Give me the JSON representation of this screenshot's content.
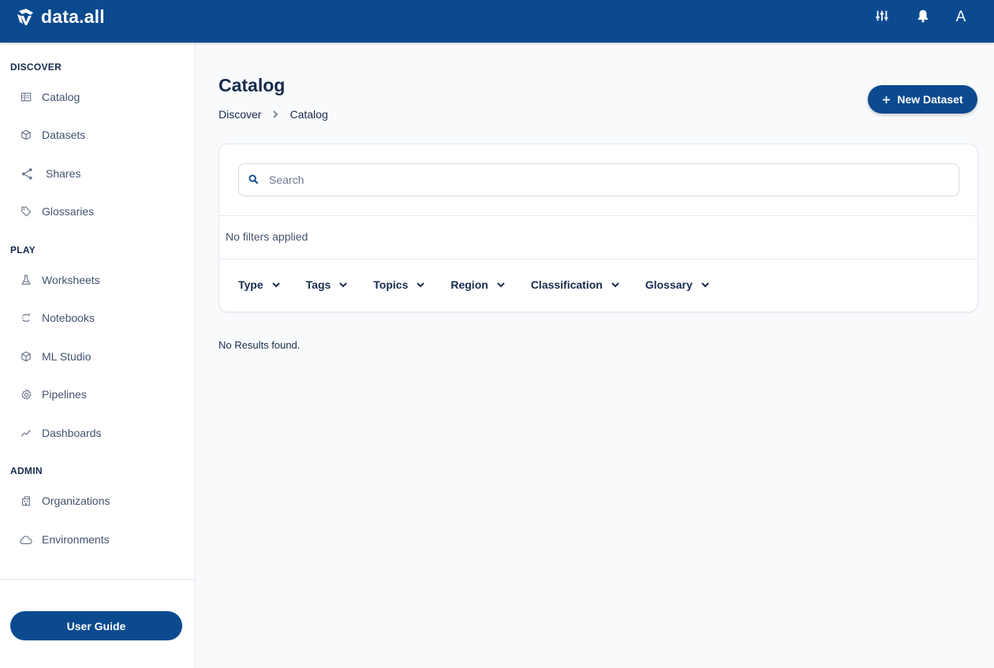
{
  "app": {
    "name": "data.all",
    "user_initial": "A"
  },
  "colors": {
    "primary": "#0b4a8f",
    "background": "#f9fafc",
    "text": "#172b4d"
  },
  "topbar": {
    "icons": [
      "settings-sliders-icon",
      "bell-icon"
    ]
  },
  "sidebar": {
    "sections": [
      {
        "title": "DISCOVER",
        "items": [
          {
            "label": "Catalog",
            "icon": "catalog-icon"
          },
          {
            "label": "Datasets",
            "icon": "cube-icon"
          },
          {
            "label": "Shares",
            "icon": "share-icon"
          },
          {
            "label": "Glossaries",
            "icon": "tag-icon"
          }
        ]
      },
      {
        "title": "PLAY",
        "items": [
          {
            "label": "Worksheets",
            "icon": "flask-icon"
          },
          {
            "label": "Notebooks",
            "icon": "notebook-icon"
          },
          {
            "label": "ML Studio",
            "icon": "cube-icon"
          },
          {
            "label": "Pipelines",
            "icon": "gear-icon"
          },
          {
            "label": "Dashboards",
            "icon": "chart-line-icon"
          }
        ]
      },
      {
        "title": "ADMIN",
        "items": [
          {
            "label": "Organizations",
            "icon": "building-icon"
          },
          {
            "label": "Environments",
            "icon": "cloud-icon"
          }
        ]
      }
    ],
    "user_guide_label": "User Guide"
  },
  "main": {
    "title": "Catalog",
    "breadcrumb": [
      "Discover",
      "Catalog"
    ],
    "new_dataset_label": "New Dataset",
    "search": {
      "placeholder": "Search",
      "value": ""
    },
    "filter_status": "No filters applied",
    "filters": [
      "Type",
      "Tags",
      "Topics",
      "Region",
      "Classification",
      "Glossary"
    ],
    "results_text": "No Results found."
  }
}
